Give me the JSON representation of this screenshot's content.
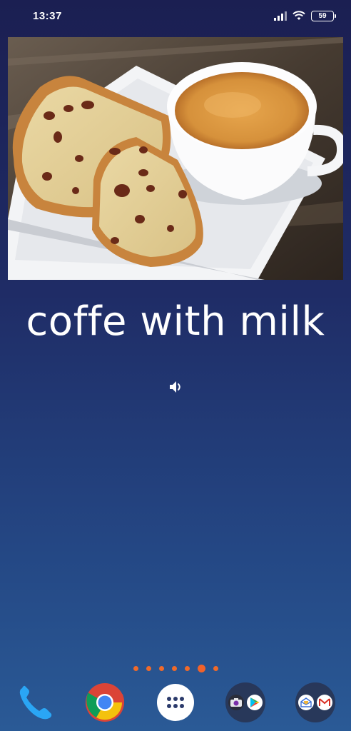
{
  "status_bar": {
    "time": "13:37",
    "battery": "59",
    "icons": [
      "signal-icon",
      "wifi-icon",
      "battery-icon"
    ]
  },
  "card": {
    "image": "coffee-with-bread-photo",
    "word": "coffe with milk",
    "audio_icon": "speaker-icon"
  },
  "page_indicator": {
    "count": 7,
    "active_index": 5,
    "color": "#f06a2a"
  },
  "dock": {
    "items": [
      {
        "name": "phone-app",
        "icon": "phone-icon"
      },
      {
        "name": "chrome-app",
        "icon": "chrome-icon"
      },
      {
        "name": "app-drawer",
        "icon": "apps-grid-icon"
      },
      {
        "name": "folder-camera-play",
        "icons": [
          "camera-icon",
          "play-store-icon"
        ]
      },
      {
        "name": "folder-mail",
        "icons": [
          "inbox-icon",
          "gmail-icon"
        ]
      }
    ]
  },
  "colors": {
    "background_top": "#1b1f52",
    "background_bottom": "#2a5a96",
    "accent": "#f06a2a"
  }
}
